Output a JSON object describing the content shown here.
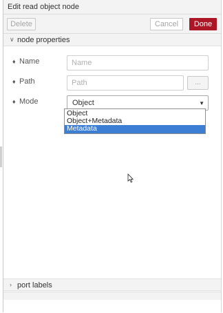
{
  "tray": {
    "title": "Edit read object node"
  },
  "toolbar": {
    "delete_label": "Delete",
    "cancel_label": "Cancel",
    "done_label": "Done",
    "done_color": "#ad1625"
  },
  "sections": {
    "node_properties": {
      "label": "node properties",
      "icon": "chevron-down-icon"
    },
    "port_labels": {
      "label": "port labels",
      "icon": "chevron-right-icon"
    }
  },
  "form": {
    "name": {
      "label": "Name",
      "icon": "tag-icon",
      "value": "",
      "placeholder": "Name"
    },
    "path": {
      "label": "Path",
      "icon": "tag-icon",
      "value": "",
      "placeholder": "Path",
      "browse_label": "..."
    },
    "mode": {
      "label": "Mode",
      "icon": "tag-icon",
      "selected": "Object",
      "options": [
        "Object",
        "Object+Metadata",
        "Metadata"
      ],
      "highlighted": "Metadata"
    }
  }
}
